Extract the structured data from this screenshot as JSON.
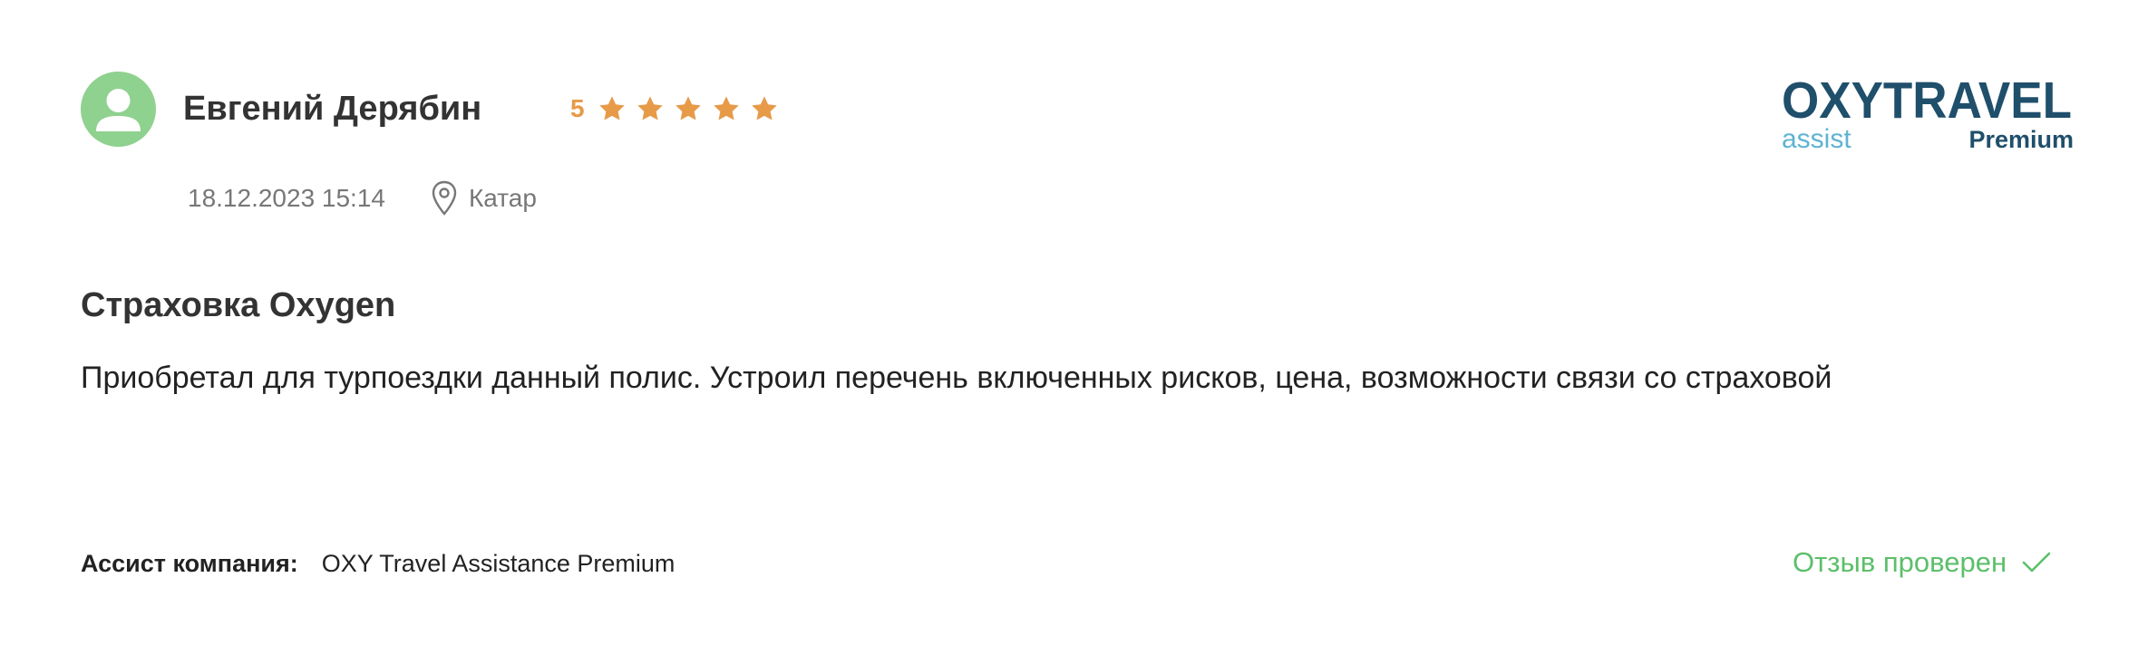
{
  "review": {
    "author": "Евгений Дерябин",
    "rating": "5",
    "stars_filled": 5,
    "date": "18.12.2023 15:14",
    "location": "Катар",
    "title": "Страховка Oxygen",
    "text": "Приобретал для турпоездки данный полис. Устроил перечень включенных рисков, цена, возможности связи со страховой",
    "assist_label": "Ассист компания:",
    "assist_company": "OXY Travel Assistance Premium",
    "verified_label": "Отзыв проверен"
  },
  "logo": {
    "brand": "OXYTRAVEL",
    "sub_left": "assist",
    "sub_right": "Premium"
  },
  "colors": {
    "avatar_bg": "#8fd18f",
    "star": "#e79a48",
    "verified": "#5cbf6a",
    "logo_dark": "#1f4f6b",
    "logo_light": "#5fb3d3"
  },
  "icons": {
    "avatar": "user-avatar-icon",
    "star": "star-icon",
    "location": "map-pin-icon",
    "verified": "checkmark-icon"
  }
}
